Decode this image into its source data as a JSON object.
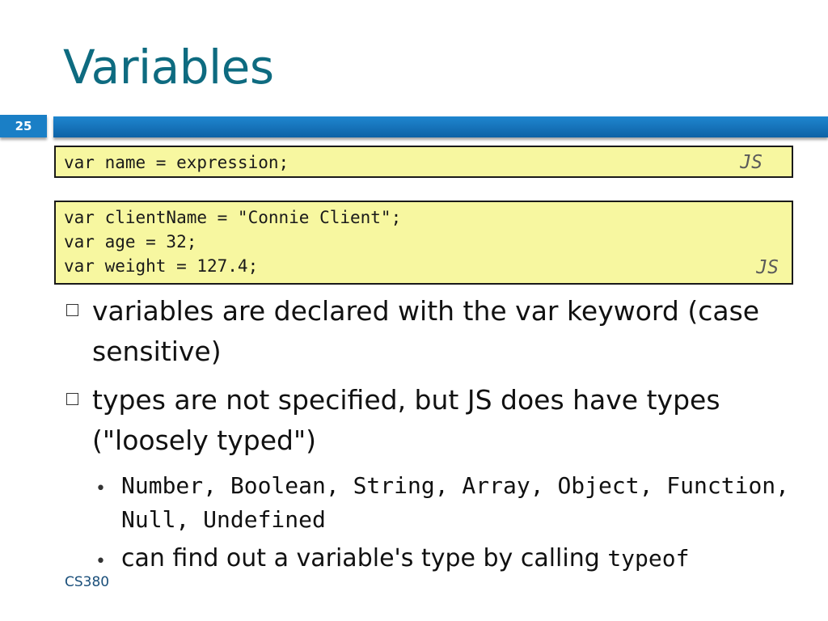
{
  "slide": {
    "title": "Variables",
    "number": "25",
    "footer": "CS380"
  },
  "code_blocks": [
    {
      "lines": [
        "var name = expression;"
      ],
      "lang": "JS"
    },
    {
      "lines": [
        "var clientName = \"Connie Client\";",
        "var age = 32;",
        "var weight = 127.4;"
      ],
      "lang": "JS"
    }
  ],
  "bullets": [
    {
      "text": "variables are declared with the var keyword (case sensitive)"
    },
    {
      "text": "types are not specified, but JS does have types (\"loosely typed\")"
    }
  ],
  "sub_bullets": [
    {
      "code": "Number, Boolean, String, Array, Object, Function, Null, Undefined"
    },
    {
      "text": "can find out a variable's type by calling ",
      "code": "typeof"
    }
  ],
  "colors": {
    "title": "#0e6b80",
    "bar": "#1a7fc6",
    "code_bg": "#f7f7a0"
  }
}
